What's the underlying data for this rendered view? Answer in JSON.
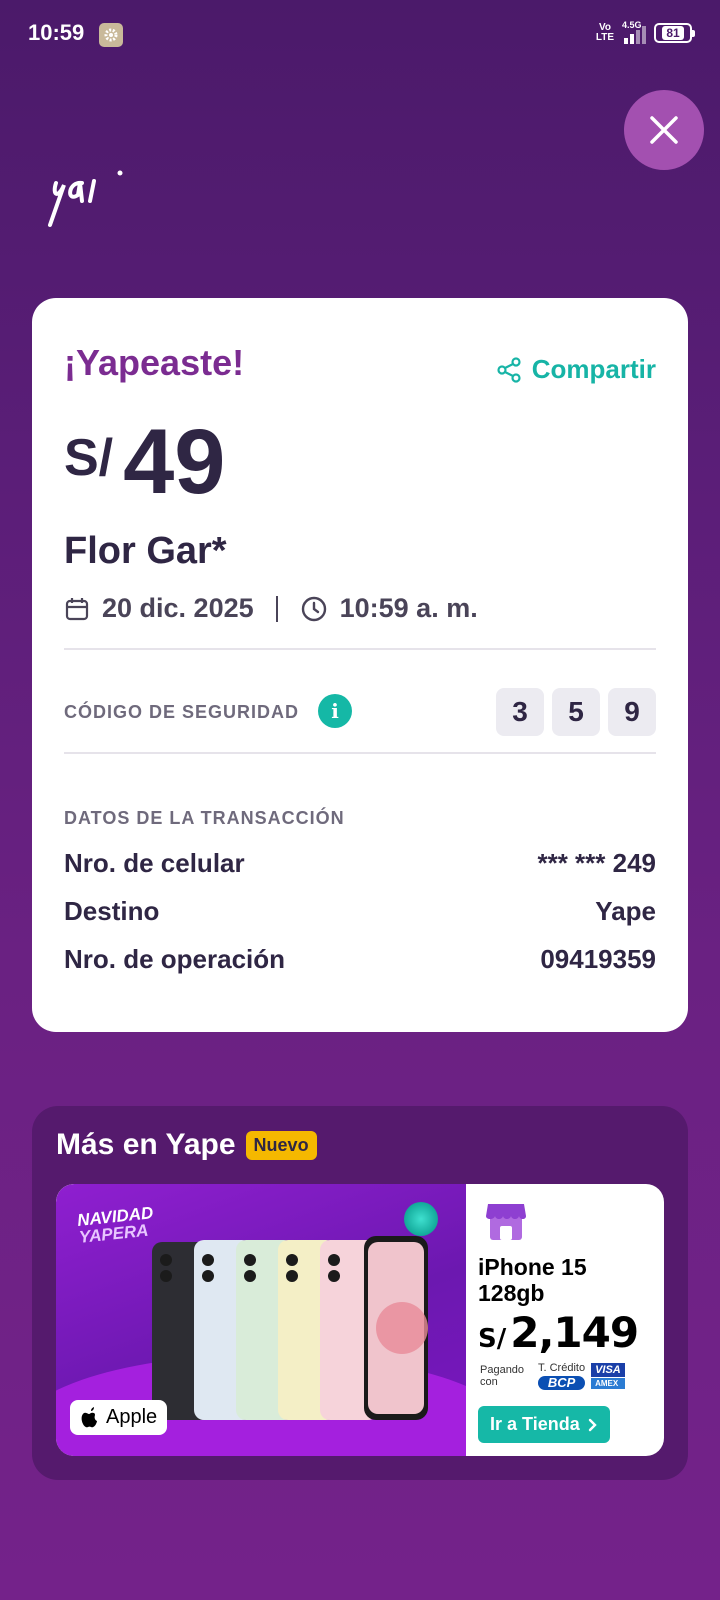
{
  "status_bar": {
    "time": "10:59",
    "volte": "Vo LTE",
    "network": "4.5G",
    "battery": "81"
  },
  "header": {
    "logo": "yape"
  },
  "receipt": {
    "title": "¡Yapeaste!",
    "share_label": "Compartir",
    "currency": "S/",
    "amount": "49",
    "recipient": "Flor Gar*",
    "date": "20 dic. 2025",
    "time": "10:59 a. m.",
    "security_code_label": "CÓDIGO DE SEGURIDAD",
    "security_code": [
      "3",
      "5",
      "9"
    ],
    "transaction_section": "DATOS DE LA TRANSACCIÓN",
    "details": [
      {
        "label": "Nro. de celular",
        "value": "*** *** 249"
      },
      {
        "label": "Destino",
        "value": "Yape"
      },
      {
        "label": "Nro. de operación",
        "value": "09419359"
      }
    ]
  },
  "promo": {
    "title": "Más en Yape",
    "badge": "Nuevo",
    "banner": {
      "campaign_line1": "NAVIDAD",
      "campaign_line2": "YAPERA",
      "brand": "Apple",
      "product_line1": "iPhone 15",
      "product_line2": "128gb",
      "price_currency": "S/",
      "price": "2,149",
      "paying_with": "Pagando con",
      "card_type": "T. Crédito",
      "bank": "BCP",
      "card_brand_1": "VISA",
      "card_brand_2": "AMEX",
      "cta": "Ir a Tienda"
    }
  },
  "colors": {
    "background": "#5b1e78",
    "accent_purple": "#7b2c91",
    "accent_teal": "#17b4a6",
    "badge_yellow": "#f5b800"
  }
}
